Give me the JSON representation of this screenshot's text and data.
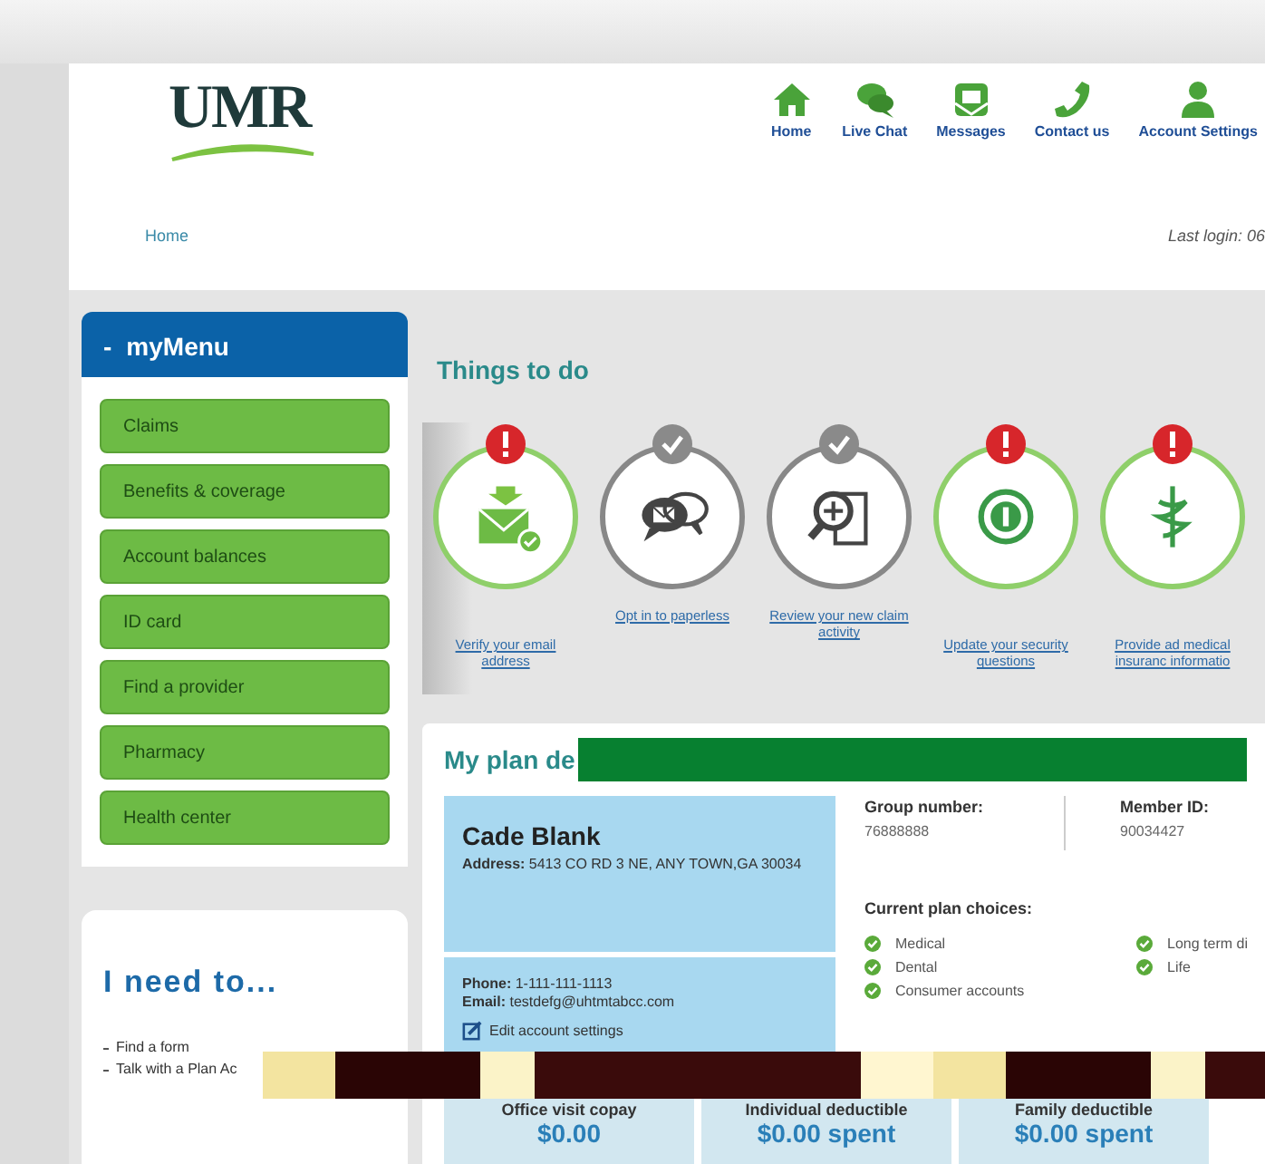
{
  "header": {
    "logo": "UMR",
    "nav": [
      {
        "label": "Home"
      },
      {
        "label": "Live Chat"
      },
      {
        "label": "Messages"
      },
      {
        "label": "Contact us"
      },
      {
        "label": "Account Settings"
      }
    ]
  },
  "breadcrumb": "Home",
  "last_login": "Last login: 06",
  "my_menu": {
    "toggle": "-",
    "title": "myMenu",
    "items": [
      "Claims",
      "Benefits & coverage",
      "Account balances",
      "ID card",
      "Find a provider",
      "Pharmacy",
      "Health center"
    ]
  },
  "i_need_to": {
    "title": "I need to...",
    "links": [
      "Find a form",
      "Talk with a Plan Ac"
    ]
  },
  "things_to_do": {
    "title": "Things to do",
    "items": [
      {
        "label": "Verify your email address",
        "alert": true,
        "selected": true
      },
      {
        "label": "Opt in to paperless",
        "alert": false,
        "selected": false
      },
      {
        "label": "Review your new claim activity",
        "alert": false,
        "selected": false
      },
      {
        "label": "Update your security questions",
        "alert": true,
        "selected": false
      },
      {
        "label": "Provide ad medical insuranc informatio",
        "alert": true,
        "selected": false
      }
    ]
  },
  "plan": {
    "title": "My plan de",
    "member": {
      "name": "Cade Blank",
      "address": "**Address:** 5413 CO RD 3 NE, ANY TOWN,GA 30034",
      "phone": "**Phone:** 1-111-111-1113",
      "email": "**Email:** testdefg@uhtmtabcc.com",
      "edit_link": "Edit account settings"
    },
    "group_label": "Group number:",
    "group_number": "76888888",
    "member_id_label": "Member ID:",
    "member_id": "90034427",
    "choices_title": "Current plan choices:",
    "choices": [
      "Medical",
      "Dental",
      "Consumer accounts",
      "Long term di",
      "Life"
    ]
  },
  "tiles": [
    {
      "label": "Office visit copay",
      "value": "$0.00"
    },
    {
      "label": "Individual deductible",
      "value": "$0.00 spent"
    },
    {
      "label": "Family deductible",
      "value": "$0.00 spent"
    }
  ]
}
